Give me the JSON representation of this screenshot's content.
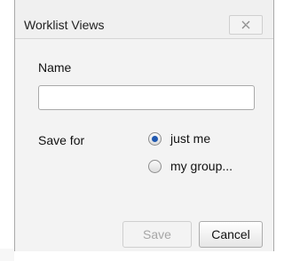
{
  "dialog": {
    "title": "Worklist Views",
    "close_icon": "close-icon",
    "name_label": "Name",
    "name_value": "",
    "name_placeholder": "",
    "save_for_label": "Save for",
    "options": [
      {
        "label": "just me",
        "selected": true
      },
      {
        "label": "my group...",
        "selected": false
      }
    ],
    "save_label": "Save",
    "cancel_label": "Cancel"
  },
  "colors": {
    "radio_selected": "#1f58b0",
    "disabled_text": "#a6a6a6"
  }
}
